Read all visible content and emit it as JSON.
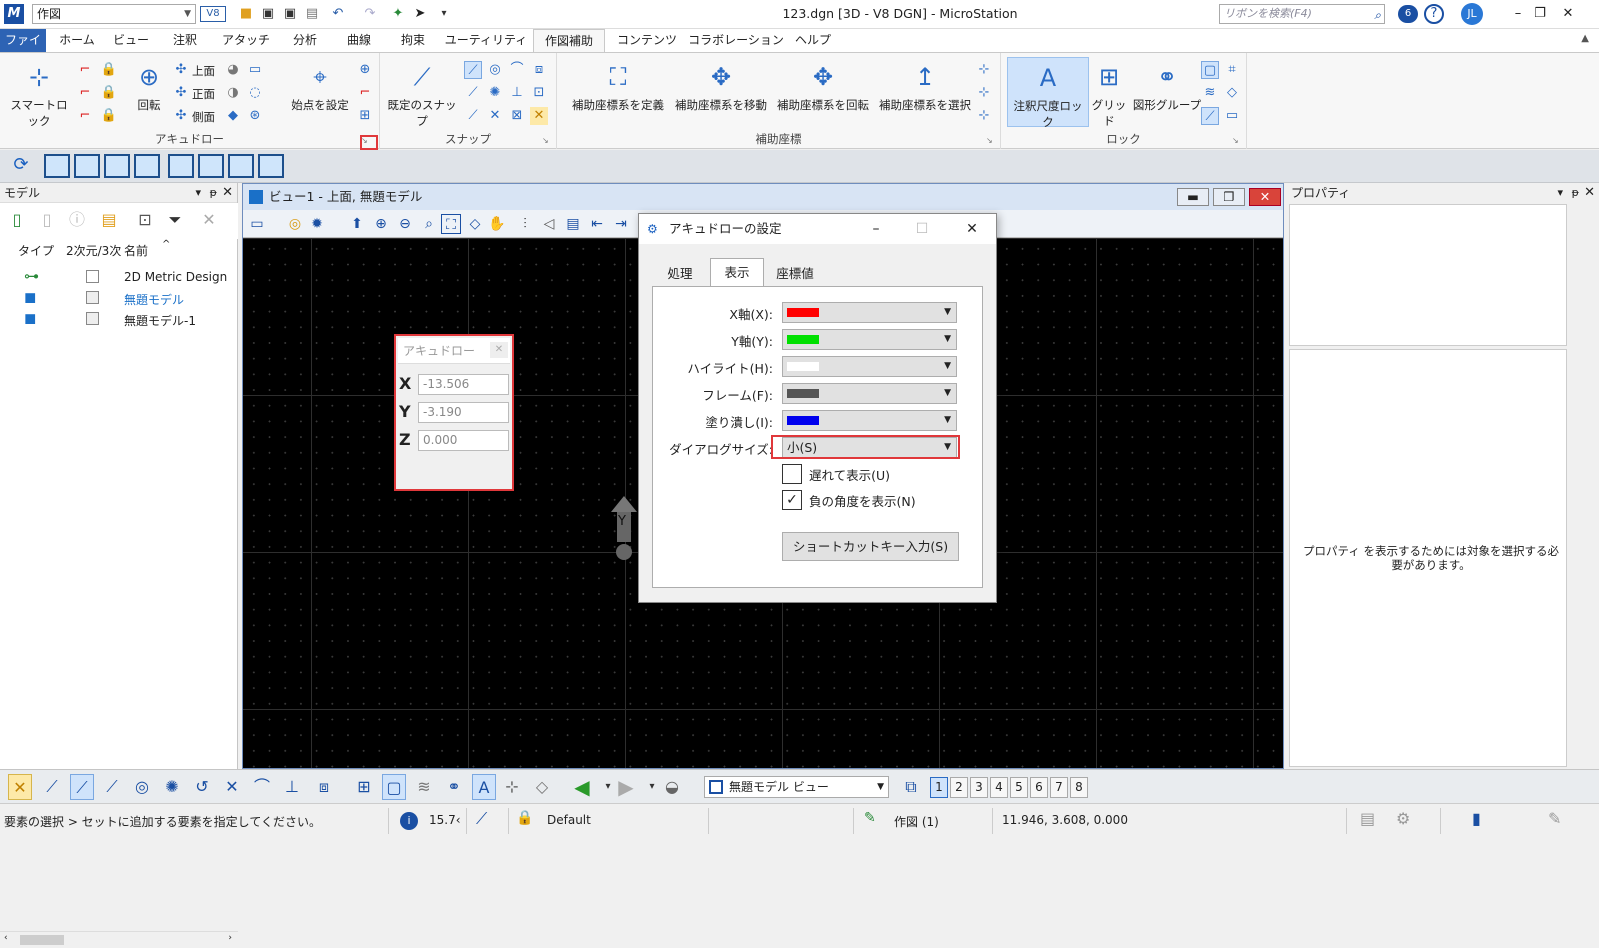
{
  "titlebar": {
    "workflow": "作図",
    "window_title": "123.dgn [3D - V8 DGN] - MicroStation",
    "search_placeholder": "リボンを検索(F4)",
    "user_initials": "JL",
    "notification_count": "6"
  },
  "tabs": [
    "ファイル",
    "ホーム",
    "ビュー",
    "注釈",
    "アタッチ",
    "分析",
    "曲線",
    "拘束",
    "ユーティリティ",
    "作図補助",
    "コンテンツ",
    "コラボレーション",
    "ヘルプ"
  ],
  "ribbon": {
    "accudraw_group": {
      "label": "アキュドロー",
      "smartlock": "スマートロック",
      "rotate": "回転",
      "top": "上面",
      "front": "正面",
      "side": "側面",
      "set_origin": "始点を設定"
    },
    "snap_group": {
      "label": "スナップ",
      "default_snap": "既定のスナップ"
    },
    "acs_group": {
      "label": "補助座標",
      "define": "補助座標系を定義",
      "move": "補助座標系を移動",
      "rotate": "補助座標系を回転",
      "select": "補助座標系を選択"
    },
    "lock_group": {
      "label": "ロック",
      "annotation_scale_lock": "注釈尺度ロック",
      "grid": "グリッド",
      "graphic_group": "図形グループ"
    }
  },
  "models_panel": {
    "title": "モデル",
    "columns": [
      "タイプ",
      "2次元/3次",
      "名前"
    ],
    "rows": [
      {
        "name": "2D Metric Design"
      },
      {
        "name": "無題モデル"
      },
      {
        "name": "無題モデル-1"
      }
    ]
  },
  "view": {
    "title": "ビュー1 - 上面, 無題モデル",
    "axis_y": "Y"
  },
  "accudraw": {
    "title": "アキュドロー",
    "x_label": "X",
    "x_value": "-13.506",
    "y_label": "Y",
    "y_value": "-3.190",
    "z_label": "Z",
    "z_value": "0.000"
  },
  "dialog": {
    "title": "アキュドローの設定",
    "tabs": [
      "処理",
      "表示",
      "座標値"
    ],
    "x_axis_label": "X軸(X):",
    "y_axis_label": "Y軸(Y):",
    "highlight_label": "ハイライト(H):",
    "frame_label": "フレーム(F):",
    "fill_label": "塗り潰し(I):",
    "dialog_size_label": "ダイアログサイズ:",
    "dialog_size_value": "小(S)",
    "delay_display": "遅れて表示(U)",
    "show_negative_angle": "負の角度を表示(N)",
    "shortcut_button": "ショートカットキー入力(S)",
    "colors": {
      "x": "#ff0000",
      "y": "#00e000",
      "highlight": "#ffffff",
      "frame": "#555555",
      "fill": "#0000ee"
    }
  },
  "properties_panel": {
    "title": "プロパティ",
    "message": "プロパティ を表示するためには対象を選択する必要があります。"
  },
  "bottombar": {
    "view_select": "無題モデル ビュー",
    "view_numbers": [
      "1",
      "2",
      "3",
      "4",
      "5",
      "6",
      "7",
      "8"
    ]
  },
  "statusbar": {
    "prompt": "要素の選択 > セットに追加する要素を指定してください。",
    "value": "15.7‹",
    "level": "Default",
    "workflow": "作図 (1)",
    "coordinates": "11.946, 3.608, 0.000"
  }
}
